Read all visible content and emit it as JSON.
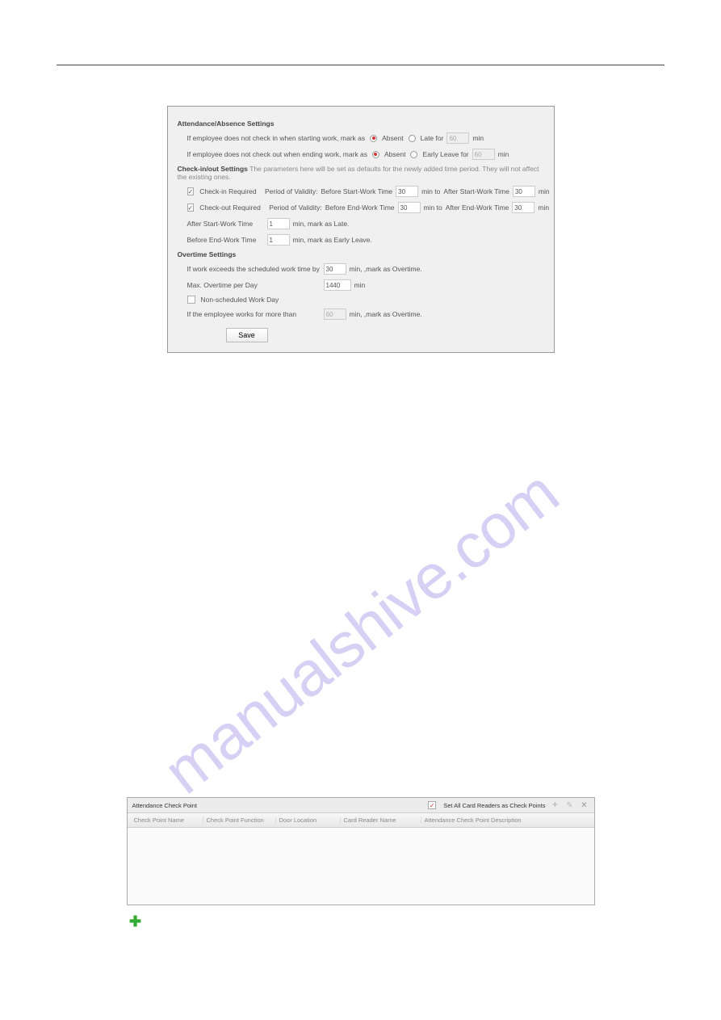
{
  "watermark": "manualshive.com",
  "settings": {
    "section1_title": "Attendance/Absence Settings",
    "row1_left": "If employee does not check in when starting work, mark as",
    "row1_absent": "Absent",
    "row1_late_for": "Late for",
    "row1_late_val": "60",
    "row1_min": "min",
    "row2_left": "If employee does not check out when ending work, mark as",
    "row2_absent": "Absent",
    "row2_early_leave_for": "Early Leave for",
    "row2_early_val": "60",
    "row2_min": "min",
    "section2_title": "Check-in/out Settings",
    "section2_hint": "The parameters here will be set as defaults for the newly added time period. They will not affect the existing ones.",
    "chk_in": "Check-in Required",
    "validity": "Period of Validity:",
    "before_start": "Before Start-Work Time",
    "after_start": "After Start-Work Time",
    "chk_out": "Check-out Required",
    "before_end": "Before End-Work Time",
    "after_end": "After End-Work Time",
    "val_30": "30",
    "min_to": "min  to",
    "min": "min",
    "late_row": "After Start-Work Time",
    "late_val": "1",
    "late_tail": "min,  mark as Late.",
    "early_row": "Before End-Work Time",
    "early_val": "1",
    "early_tail": "min,  mark as Early Leave.",
    "section3_title": "Overtime Settings",
    "ot_row1": "If work exceeds the scheduled work time by",
    "ot_row1_val": "30",
    "ot_row1_tail": "min,  ,mark as Overtime.",
    "ot_row2": "Max. Overtime per Day",
    "ot_row2_val": "1440",
    "ot_row2_tail": "min",
    "nonsched": "Non-scheduled Work Day",
    "ot_row3": "If the employee works for more than",
    "ot_row3_val": "60",
    "ot_row3_tail": "min,  ,mark as Overtime.",
    "save": "Save"
  },
  "checkpoint": {
    "title": "Attendance Check Point",
    "toggle": "Set All Card Readers as Check Points",
    "col1": "Check Point Name",
    "col2": "Check Point Function",
    "col3": "Door Location",
    "col4": "Card Reader Name",
    "col5": "Attendance Check Point Description"
  }
}
